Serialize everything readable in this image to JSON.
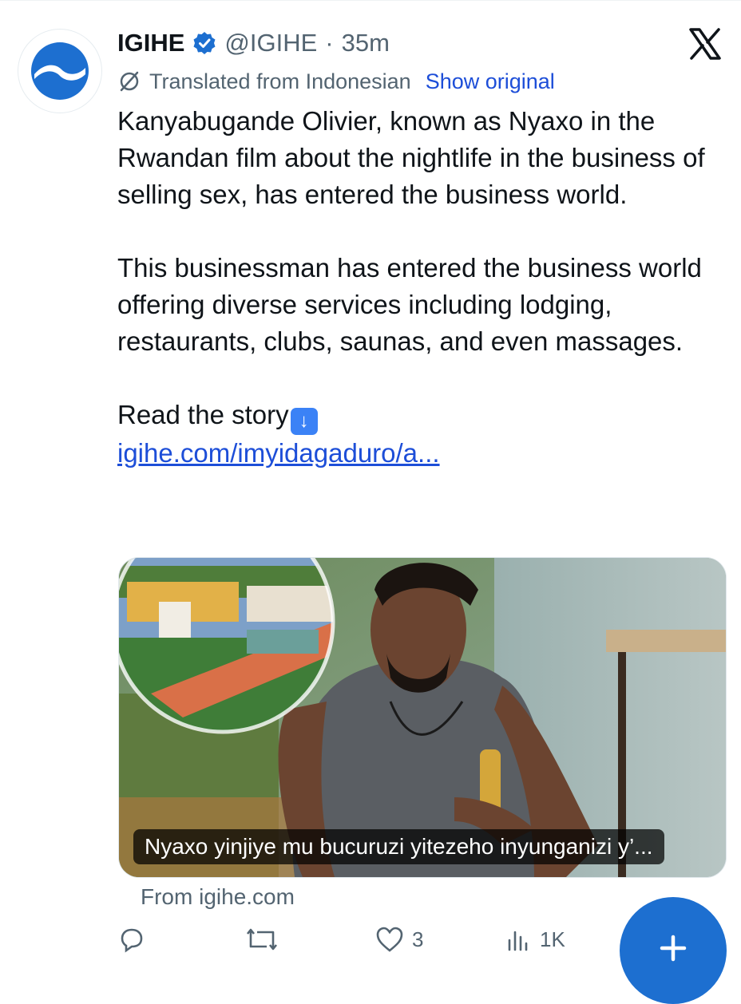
{
  "tweet": {
    "author_name": "IGIHE",
    "handle": "@IGIHE",
    "separator": "·",
    "time": "35m",
    "translated_label": "Translated from Indonesian",
    "show_original_label": "Show original",
    "paragraphs": [
      "Kanyabugande Olivier, known as Nyaxo in the Rwandan film about the nightlife in the business of selling sex, has entered the business world.",
      "This businessman has entered the business world offering diverse services including lodging, restaurants, clubs, saunas, and even massages."
    ],
    "read_story": "Read the story",
    "link_text": "igihe.com/imyidagaduro/a...",
    "card": {
      "caption": "Nyaxo yinjiye mu bucuruzi yitezeho inyunganizi y’...",
      "from": "From igihe.com"
    },
    "actions": {
      "reply_count": "",
      "retweet_count": "",
      "like_count": "3",
      "views_count": "1K"
    }
  },
  "colors": {
    "brand_blue": "#1d6fd0",
    "link_blue": "#1d4ed8",
    "muted": "#536471",
    "text": "#0f1419"
  },
  "icons": [
    "igihe-logo-icon",
    "verified-badge-icon",
    "x-logo-icon",
    "translate-icon",
    "down-arrow-emoji-icon",
    "reply-icon",
    "retweet-icon",
    "like-icon",
    "views-icon",
    "compose-plus-icon"
  ]
}
